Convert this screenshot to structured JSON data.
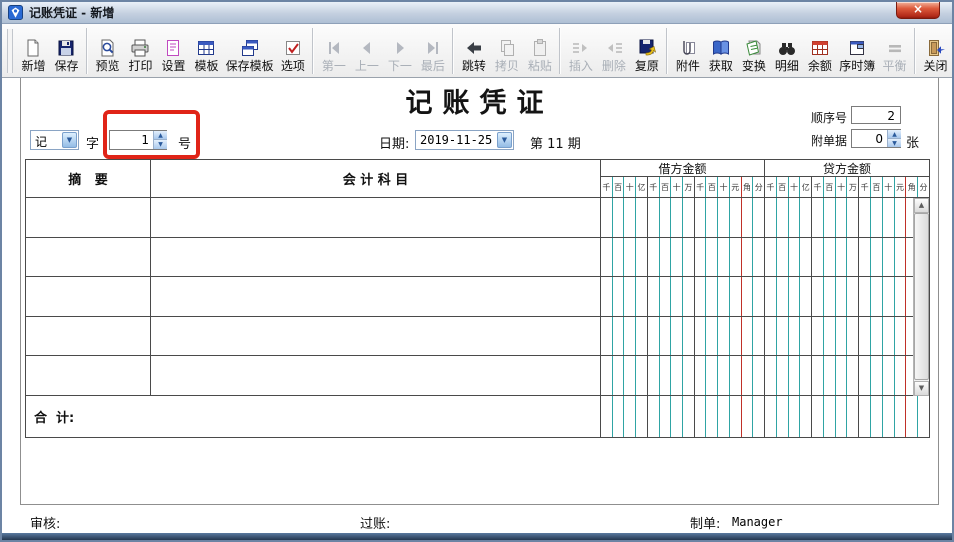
{
  "window": {
    "title": "记账凭证 - 新增",
    "close_glyph": "×",
    "app_icon": "voucher-app-icon"
  },
  "toolbar": {
    "buttons": [
      {
        "label": "新增",
        "icon": "new-doc-icon",
        "enabled": true
      },
      {
        "label": "保存",
        "icon": "save-icon",
        "enabled": true
      },
      {
        "label": "预览",
        "icon": "preview-icon",
        "enabled": true
      },
      {
        "label": "打印",
        "icon": "print-icon",
        "enabled": true
      },
      {
        "label": "设置",
        "icon": "setup-icon",
        "enabled": true
      },
      {
        "label": "模板",
        "icon": "template-icon",
        "enabled": true
      },
      {
        "label": "保存模板",
        "icon": "save-template-icon",
        "enabled": true
      },
      {
        "label": "选项",
        "icon": "options-icon",
        "enabled": true
      },
      {
        "label": "第一",
        "icon": "first-icon",
        "enabled": false
      },
      {
        "label": "上一",
        "icon": "previous-icon",
        "enabled": false
      },
      {
        "label": "下一",
        "icon": "next-icon",
        "enabled": false
      },
      {
        "label": "最后",
        "icon": "last-icon",
        "enabled": false
      },
      {
        "label": "跳转",
        "icon": "jump-icon",
        "enabled": true
      },
      {
        "label": "拷贝",
        "icon": "copy-icon",
        "enabled": false
      },
      {
        "label": "粘贴",
        "icon": "paste-icon",
        "enabled": false
      },
      {
        "label": "插入",
        "icon": "insert-icon",
        "enabled": false
      },
      {
        "label": "删除",
        "icon": "delete-icon",
        "enabled": false
      },
      {
        "label": "复原",
        "icon": "restore-icon",
        "enabled": true
      },
      {
        "label": "附件",
        "icon": "attachment-icon",
        "enabled": true
      },
      {
        "label": "获取",
        "icon": "fetch-icon",
        "enabled": true
      },
      {
        "label": "变换",
        "icon": "transform-icon",
        "enabled": true
      },
      {
        "label": "明细",
        "icon": "detail-icon",
        "enabled": true
      },
      {
        "label": "余额",
        "icon": "balance-table-icon",
        "enabled": true
      },
      {
        "label": "序时簿",
        "icon": "journal-icon",
        "enabled": true
      },
      {
        "label": "平衡",
        "icon": "equalize-icon",
        "enabled": false
      },
      {
        "label": "关闭",
        "icon": "close-door-icon",
        "enabled": true
      }
    ]
  },
  "header": {
    "title": "记账凭证",
    "seq_label": "顺序号",
    "seq_value": "2",
    "attach_label": "附单据",
    "attach_value": "0",
    "attach_unit": "张"
  },
  "voucher": {
    "word_value": "记",
    "word_suffix": "字",
    "no_value": "1",
    "no_suffix": "号",
    "date_label": "日期:",
    "date_value": "2019-11-25",
    "period_text": "第 11 期"
  },
  "table": {
    "summary_header": "摘   要",
    "subject_header": "会 计 科 目",
    "debit_header": "借方金额",
    "credit_header": "贷方金额",
    "digits": [
      "千",
      "百",
      "十",
      "亿",
      "千",
      "百",
      "十",
      "万",
      "千",
      "百",
      "十",
      "元",
      "角",
      "分"
    ],
    "body_row_count": 5,
    "total_label": "合  计:"
  },
  "footer": {
    "review_label": "审核:",
    "post_label": "过账:",
    "maker_label": "制单:",
    "maker_value": "Manager"
  },
  "glyphs": {
    "up": "▲",
    "down": "▼",
    "dropdown": "▼"
  },
  "colors": {
    "grid_teal": "#2fa4a4",
    "grid_red": "#c03028",
    "grid_dark": "#4a4a4a",
    "annotation_red": "#e02418",
    "titlebar_top": "#eaf0f8",
    "titlebar_bottom": "#aebfd4",
    "close_button_red": "#b02818",
    "disabled_text": "#a9afb7"
  }
}
